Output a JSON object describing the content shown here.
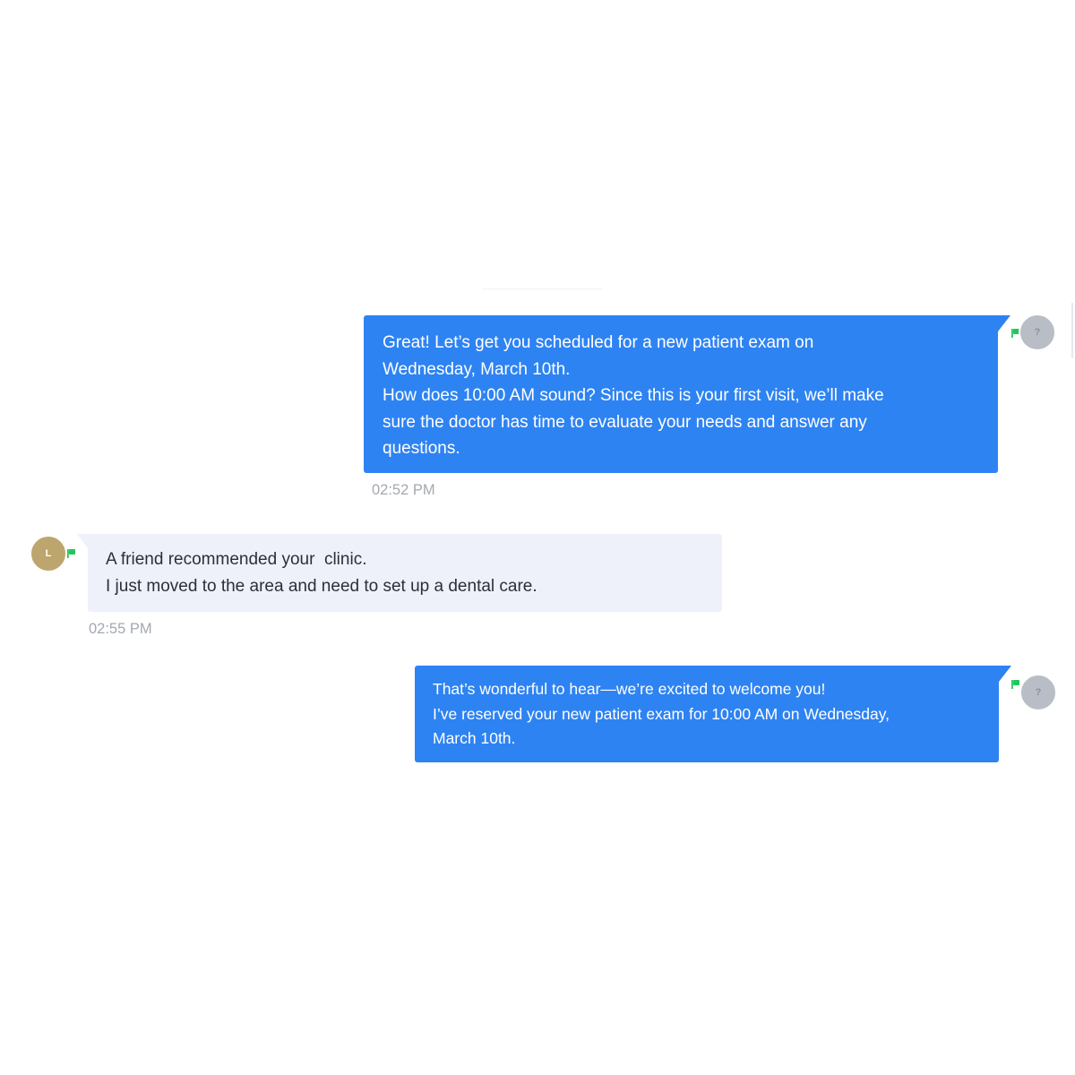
{
  "messages": [
    {
      "direction": "outgoing",
      "lines": [
        "Great! Let’s get you scheduled for a new patient exam on",
        "Wednesday, March 10th.",
        "How does 10:00 AM sound? Since this is your first visit, we’ll make",
        "sure the doctor has time to evaluate your needs and answer any",
        "questions."
      ],
      "timestamp": "02:52 PM",
      "avatar_initial": "?"
    },
    {
      "direction": "incoming",
      "lines": [
        "A friend recommended your  clinic.",
        "I just moved to the area and need to set up a dental care."
      ],
      "timestamp": "02:55 PM",
      "avatar_initial": "L"
    },
    {
      "direction": "outgoing",
      "lines": [
        "That’s wonderful to hear—we’re excited to welcome you!",
        "I’ve reserved your new patient exam for 10:00 AM on Wednesday,",
        "March 10th."
      ],
      "avatar_initial": "?"
    }
  ],
  "icons": {
    "channel": "flag-icon"
  },
  "colors": {
    "outgoing_bubble": "#2e83f2",
    "incoming_bubble": "#eef1f9",
    "channel_icon": "#22c55e",
    "user_avatar": "#bda66e",
    "agent_avatar": "#b9bec6",
    "timestamp": "#a4a8b0"
  }
}
